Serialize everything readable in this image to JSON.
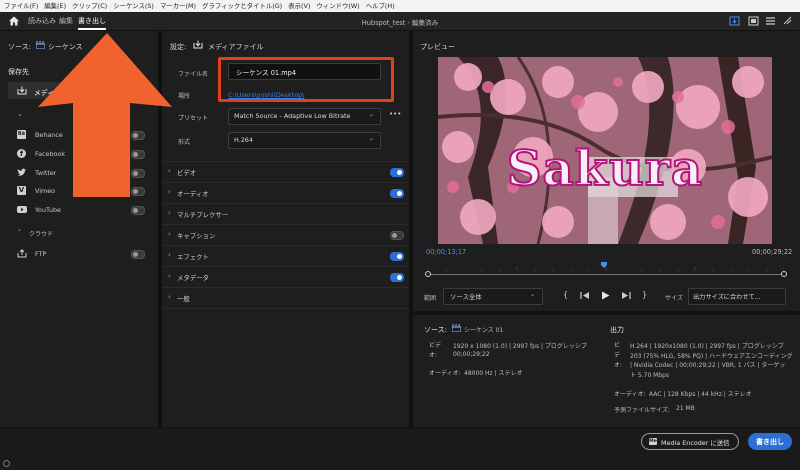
{
  "menubar": {
    "items": [
      "ファイル(F)",
      "編集(E)",
      "クリップ(C)",
      "シーケンス(S)",
      "マーカー(M)",
      "グラフィックとタイトル(G)",
      "表示(V)",
      "ウィンドウ(W)",
      "ヘルプ(H)"
    ]
  },
  "topbar": {
    "tabs": [
      "読み込み",
      "編集",
      "書き出し"
    ],
    "title": "Hubspot_test - 編集済み"
  },
  "left": {
    "source_label": "ソース:",
    "source_value": "シーケンス",
    "save_to": "保存先",
    "media_file": "メディアファイル",
    "platforms": [
      "Behance",
      "Facebook",
      "Twitter",
      "Vimeo",
      "YouTube"
    ],
    "cloud": "クラウド",
    "ftp": "FTP"
  },
  "settings": {
    "header_label": "設定:",
    "header_value": "メディアファイル",
    "filename_label": "ファイル名",
    "filename_value": "シーケンス 01.mp4",
    "location_label": "場所",
    "location_value": "C:\\Users\\yoshi\\Desktop\\",
    "preset_label": "プリセット",
    "preset_value": "Match Source - Adaptive Low Bitrate",
    "format_label": "形式",
    "format_value": "H.264",
    "more": "•••",
    "sections": [
      {
        "label": "ビデオ",
        "toggle": true,
        "on": true
      },
      {
        "label": "オーディオ",
        "toggle": true,
        "on": true
      },
      {
        "label": "マルチプレクサー",
        "toggle": false,
        "on": false
      },
      {
        "label": "キャプション",
        "toggle": true,
        "on": false
      },
      {
        "label": "エフェクト",
        "toggle": true,
        "on": true
      },
      {
        "label": "メタデータ",
        "toggle": true,
        "on": true
      },
      {
        "label": "一般",
        "toggle": false,
        "on": false
      }
    ]
  },
  "preview": {
    "title": "プレビュー",
    "overlay_text": "Sakura",
    "timecode_current": "00;00;13;17",
    "timecode_total": "00;00;29;22",
    "playhead_fraction": 0.495,
    "range_label": "範囲",
    "range_value": "ソース全体",
    "size_label": "サイズ",
    "size_value": "出力サイズに合わせて..."
  },
  "summary": {
    "source_label": "ソース:",
    "source_value": "シーケンス 01",
    "video_label": "ビデオ:",
    "video_value_1": "1920 x 1080 (1.0)  |  2997 fps  |  プログレッシブ",
    "video_value_2": "00;00;29;22",
    "audio_label": "オーディオ:",
    "audio_value": "48000 Hz  |  ステレオ",
    "output_label": "出力",
    "out_video_label": "ビデオ:",
    "out_video_1": "H.264  |  1920x1080 (1.0)  |  2997 fps  |  プログレッシブ",
    "out_video_2": "203 (75% HLG, 58% PQ)  |  ハードウェアエンコーディング",
    "out_video_3": "|  Nvidia Codec  |  00;00;29;22  |  VBR, 1 パス  |  ターゲット 5.70 Mbps",
    "out_audio_label": "オーディオ:",
    "out_audio_value": "AAC  |  128 Kbps  |  44 kHz  |  ステレオ",
    "filesize_label": "予測ファイルサイズ:",
    "filesize_value": "21 MB"
  },
  "footer": {
    "media_encoder": "Media Encoder に送信",
    "export": "書き出し"
  },
  "colors": {
    "accent": "#2d6fd6",
    "arrow": "#f2622e",
    "highlight": "#e0401b",
    "link": "#3b82e0"
  }
}
